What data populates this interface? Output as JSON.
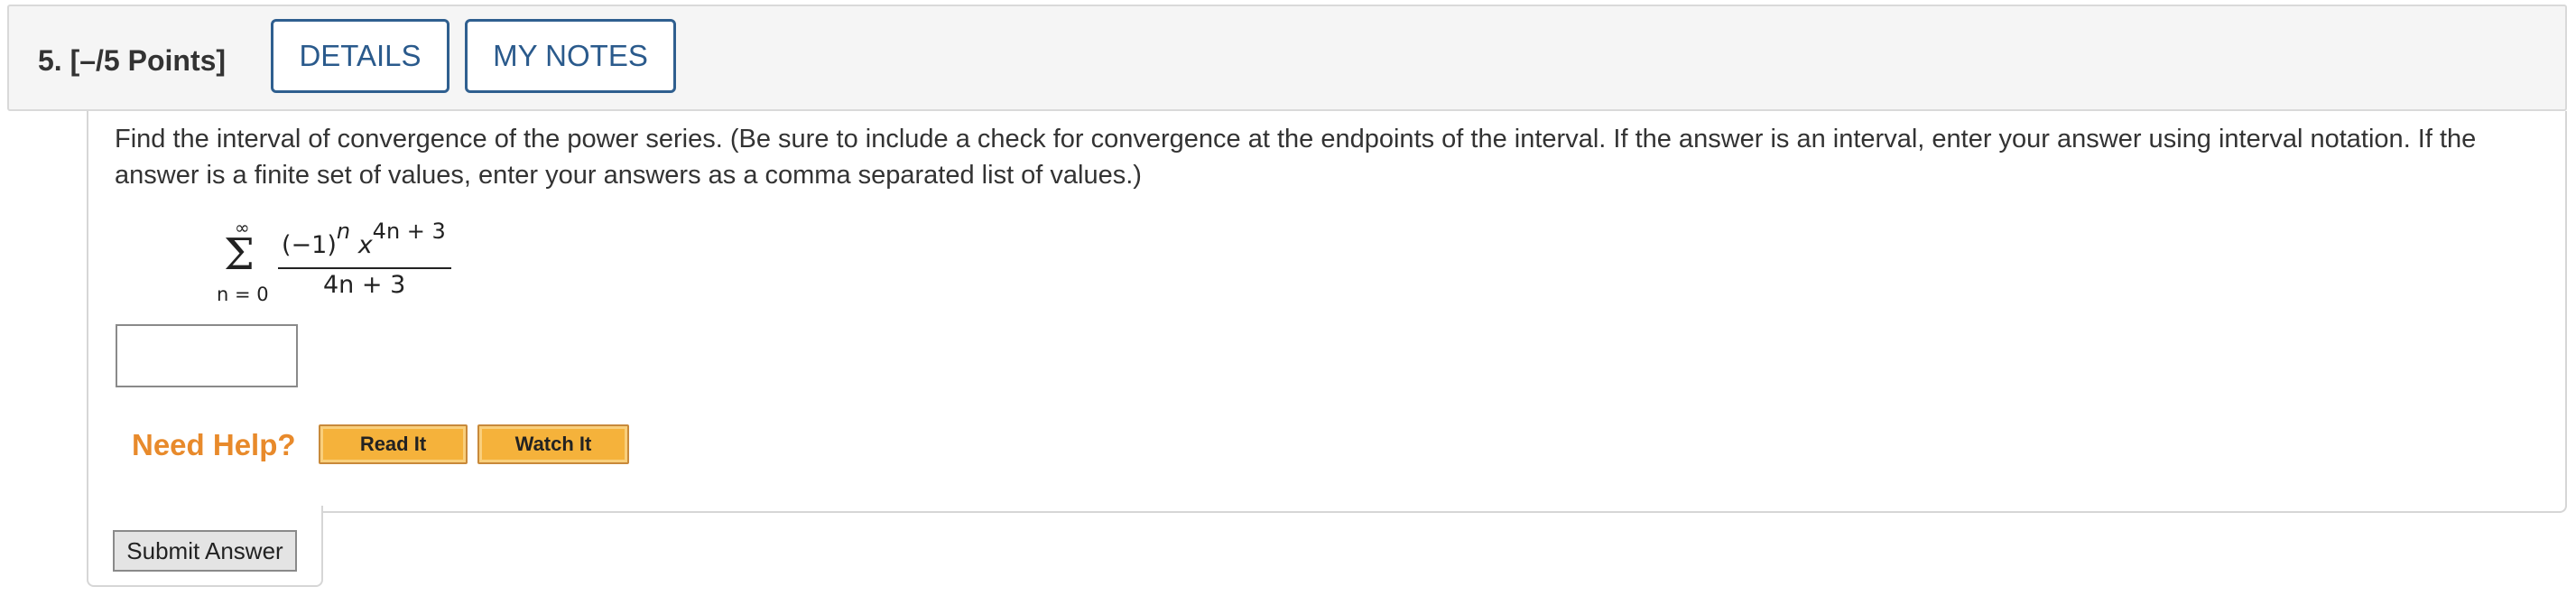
{
  "question": {
    "number": "5.",
    "points": "[–/5 Points]",
    "tabs": {
      "details": "DETAILS",
      "my_notes": "MY NOTES"
    }
  },
  "prompt": "Find the interval of convergence of the power series. (Be sure to include a check for convergence at the endpoints of the interval. If the answer is an interval, enter your answer using interval notation. If the answer is a finite set of values, enter your answers as a comma separated list of values.)",
  "series": {
    "upper_limit": "∞",
    "sigma": "Σ",
    "lower_limit": "n = 0",
    "numerator_base": "(−1)",
    "numerator_n_exp": "n",
    "numerator_x": "x",
    "numerator_x_exp": "4n + 3",
    "denominator": "4n + 3"
  },
  "answer": {
    "value": ""
  },
  "help": {
    "label": "Need Help?",
    "read_it": "Read It",
    "watch_it": "Watch It"
  },
  "submit_label": "Submit Answer",
  "colors": {
    "tab_text": "#2a5a8c",
    "need_help": "#e88a2b",
    "help_button": "#f5b23b"
  }
}
